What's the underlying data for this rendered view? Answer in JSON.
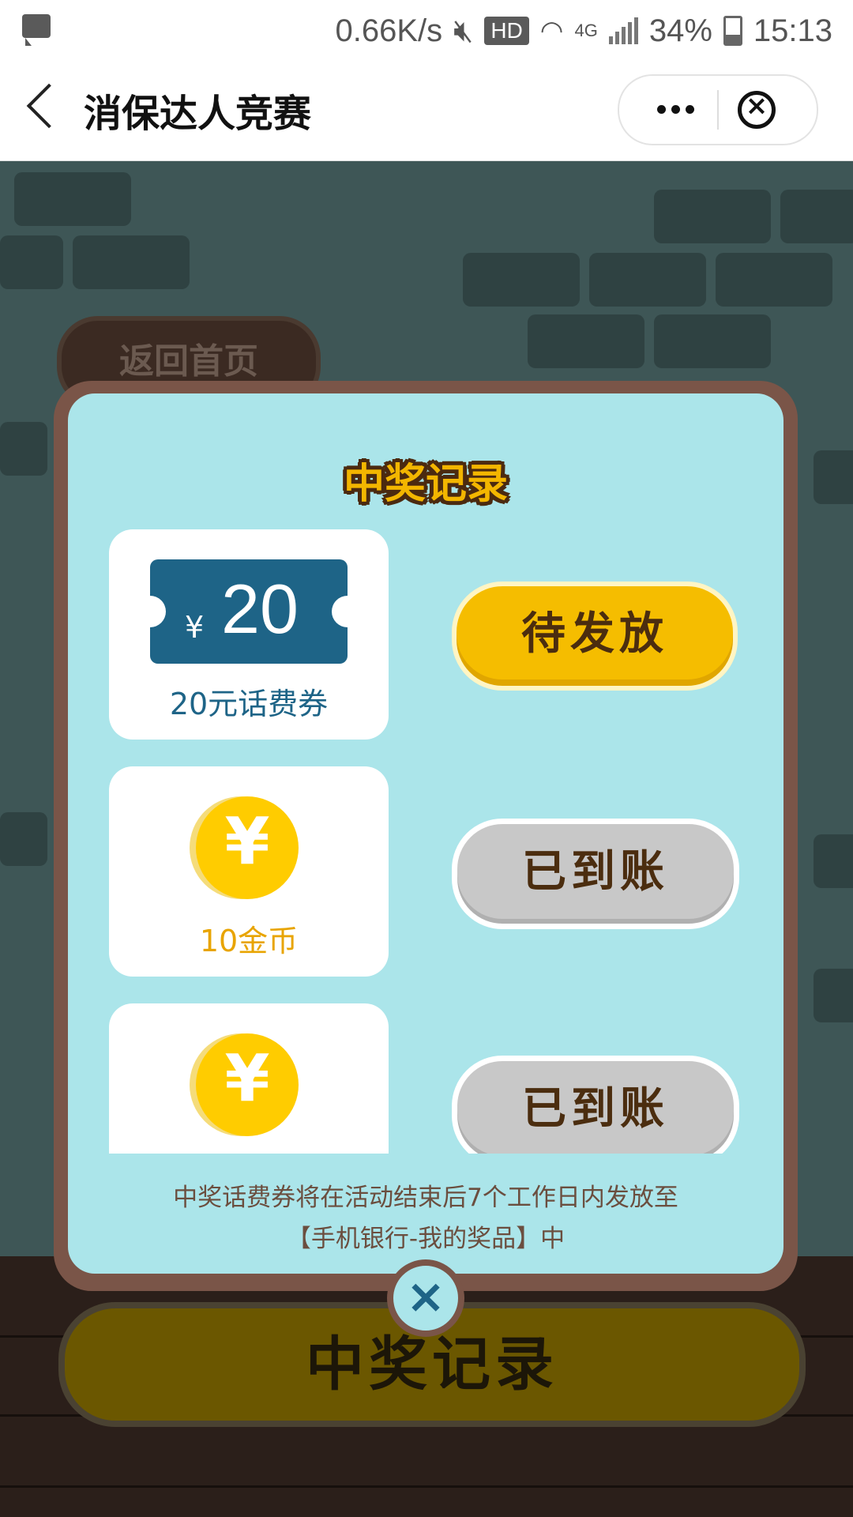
{
  "status_bar": {
    "speed": "0.66K/s",
    "hd": "HD",
    "net": "4G",
    "battery": "34%",
    "time": "15:13"
  },
  "nav": {
    "title": "消保达人竞赛"
  },
  "background": {
    "home_button": "返回首页",
    "records_button": "中奖记录"
  },
  "modal": {
    "title": "中奖记录",
    "records": [
      {
        "prize_type": "coupon",
        "currency": "¥",
        "amount": "20",
        "label": "20元话费券",
        "status": "待发放"
      },
      {
        "prize_type": "coin",
        "symbol": "¥",
        "label": "10金币",
        "status": "已到账"
      },
      {
        "prize_type": "coin",
        "symbol": "¥",
        "label": "",
        "status": "已到账"
      }
    ],
    "note_line1": "中奖话费券将在活动结束后7个工作日内发放至",
    "note_line2": "【手机银行-我的奖品】中",
    "close_symbol": "×"
  }
}
